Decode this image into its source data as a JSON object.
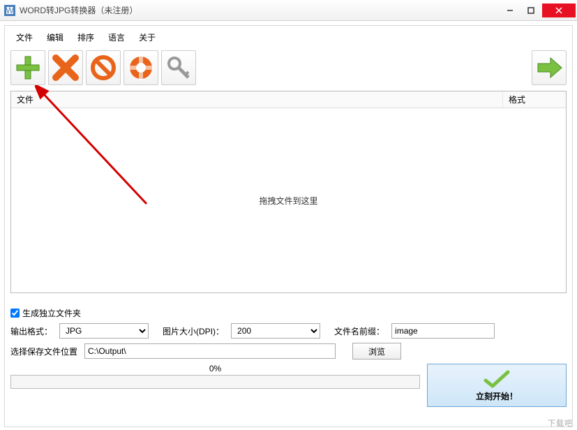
{
  "window": {
    "title": "WORD转JPG转换器（未注册）"
  },
  "menu": {
    "file": "文件",
    "edit": "编辑",
    "sort": "排序",
    "language": "语言",
    "about": "关于"
  },
  "toolbar": {
    "add": "add-icon",
    "remove": "remove-icon",
    "clear": "clear-icon",
    "help": "help-icon",
    "register": "key-icon",
    "start": "start-icon"
  },
  "table": {
    "col_file": "文件",
    "col_format": "格式",
    "drop_hint": "拖拽文件到这里"
  },
  "options": {
    "separate_folder_label": "生成独立文件夹",
    "separate_folder_checked": true,
    "output_format_label": "输出格式：",
    "output_format_value": "JPG",
    "dpi_label": "图片大小(DPI)：",
    "dpi_value": "200",
    "prefix_label": "文件名前缀：",
    "prefix_value": "image",
    "save_path_label": "选择保存文件位置",
    "save_path_value": "C:\\Output\\",
    "browse_label": "浏览"
  },
  "progress": {
    "percent_text": "0%"
  },
  "action": {
    "start_label": "立刻开始！"
  },
  "watermark": "下载吧"
}
